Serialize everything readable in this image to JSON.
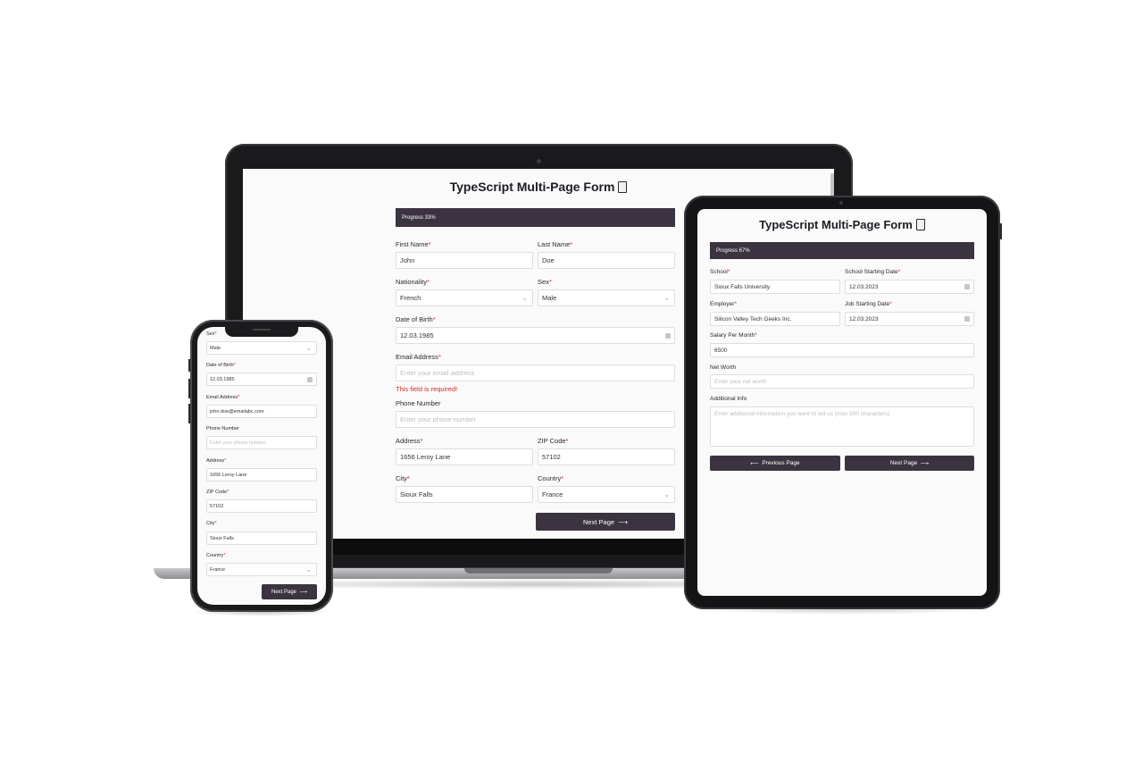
{
  "laptop": {
    "title": "TypeScript Multi-Page Form",
    "progress": "Progress 33%",
    "progress_value": 0.33,
    "first_name_label": "First Name",
    "first_name_value": "John",
    "last_name_label": "Last Name",
    "last_name_value": "Doe",
    "nationality_label": "Nationality",
    "nationality_value": "French",
    "sex_label": "Sex",
    "sex_value": "Male",
    "dob_label": "Date of Birth",
    "dob_value": "12.03.1985",
    "email_label": "Email Address",
    "email_placeholder": "Enter your email address",
    "email_error": "This field is required!",
    "phone_label": "Phone Number",
    "phone_placeholder": "Enter your phone number",
    "address_label": "Address",
    "address_value": "1656 Leroy Lane",
    "zip_label": "ZIP Code",
    "zip_value": "57102",
    "city_label": "City",
    "city_value": "Sioux Falls",
    "country_label": "Country",
    "country_value": "France",
    "next_label": "Next Page",
    "required_mark": "*",
    "arrow": "⟶"
  },
  "tablet": {
    "title": "TypeScript Multi-Page Form",
    "progress": "Progress 67%",
    "progress_value": 0.67,
    "school_label": "School",
    "school_value": "Sioux Falls University",
    "school_start_label": "School Starting Date",
    "school_start_value": "12.03.2023",
    "employer_label": "Employer",
    "employer_value": "Silicon Valley Tech Geeks Inc.",
    "job_start_label": "Job Starting Date",
    "job_start_value": "12.03.2023",
    "salary_label": "Salary Per Month",
    "salary_value": "6500",
    "net_worth_label": "Net Worth",
    "net_worth_placeholder": "Enter your net worth",
    "additional_label": "Additional Info",
    "additional_placeholder": "Enter additional information you want to tell us (max 500 characters)",
    "previous_label": "Previous Page",
    "next_label": "Next Page",
    "arrow_left": "⟵",
    "arrow_right": "⟶"
  },
  "phone": {
    "sex_label": "Sex",
    "sex_value": "Male",
    "dob_label": "Date of Birth",
    "dob_value": "12.03.1985",
    "email_label": "Email Address",
    "email_value": "john.doe@emailabc.com",
    "phone_label": "Phone Number",
    "phone_placeholder": "Enter your phone number",
    "address_label": "Address",
    "address_value": "1656 Leroy Lane",
    "zip_label": "ZIP Code",
    "zip_value": "57102",
    "city_label": "City",
    "city_value": "Sioux Falls",
    "country_label": "Country",
    "country_value": "France",
    "next_label": "Next Page",
    "arrow": "⟶"
  },
  "colors": {
    "accent": "#3b3340",
    "required": "#d22b2b",
    "page_bg": "#fafafa"
  },
  "icons": [
    "document-icon",
    "calendar-icon",
    "chevron-down-icon",
    "arrow-right-icon",
    "arrow-left-icon"
  ]
}
